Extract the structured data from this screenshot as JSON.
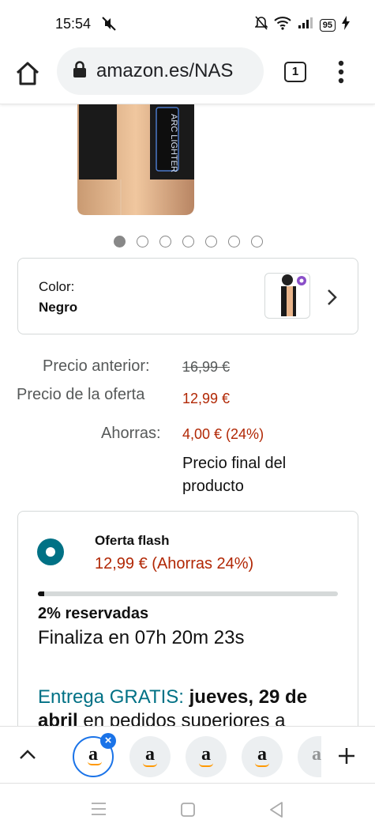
{
  "status_bar": {
    "time": "15:54",
    "battery": "95",
    "icons": [
      "mute-icon",
      "alarm-off-icon",
      "wifi-icon",
      "signal-icon",
      "battery-icon",
      "charging-icon"
    ]
  },
  "browser": {
    "url": "amazon.es/NAS",
    "tab_count": "1",
    "icons": [
      "home-icon",
      "lock-icon",
      "menu-icon"
    ]
  },
  "product": {
    "image_text": "ARC LIGHTER",
    "carousel": {
      "total": 7,
      "active": 0
    }
  },
  "color_selector": {
    "label": "Color:",
    "value": "Negro"
  },
  "price": {
    "previous_label": "Precio anterior:",
    "previous_value": "16,99 €",
    "deal_label": "Precio de la oferta",
    "deal_value": "12,99 €",
    "savings_label": "Ahorras:",
    "savings_value": "4,00 € (24%)",
    "final_note": "Precio final del producto"
  },
  "offer": {
    "title": "Oferta flash",
    "price": "12,99 € (Ahorras 24%)",
    "reserved_percent": 2,
    "reserved_text": "2% reservadas",
    "ends_text": "Finaliza en 07h 20m 23s",
    "delivery_prefix": "Entrega GRATIS:",
    "delivery_date": "jueves, 29 de abril",
    "delivery_suffix": "en pedidos superiores a"
  },
  "tab_bar": {
    "tab_letter": "a",
    "close_symbol": "×",
    "tabs": 5
  },
  "colors": {
    "teal": "#007185",
    "price_red": "#b12704",
    "tab_blue": "#1a73e8"
  }
}
